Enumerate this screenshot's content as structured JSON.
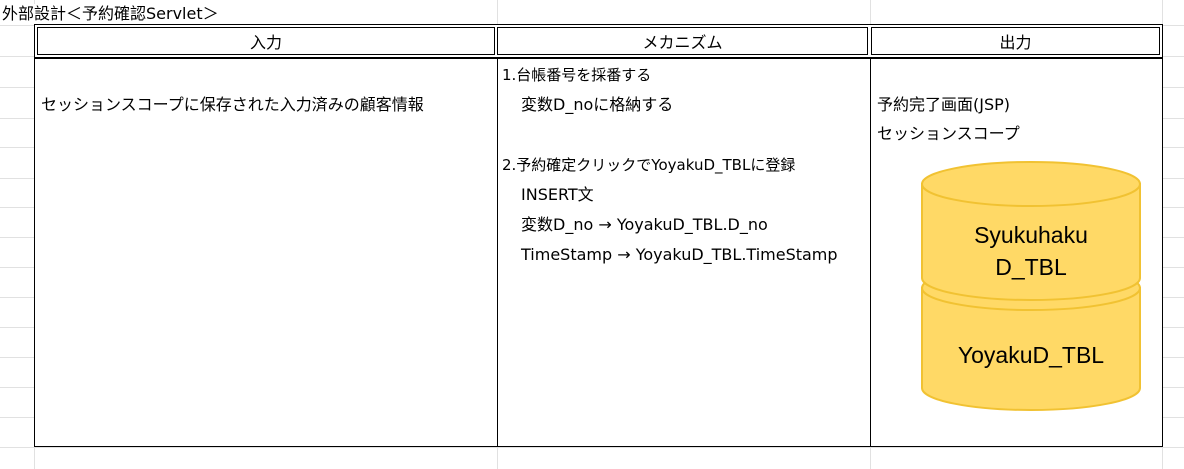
{
  "sheet": {
    "title": "外部設計＜予約確認Servlet＞"
  },
  "table": {
    "headers": [
      "入力",
      "メカニズム",
      "出力"
    ],
    "input": {
      "text": "セッションスコープに保存された入力済みの顧客情報"
    },
    "mechanism": {
      "step1_title": "1.台帳番号を採番する",
      "step1_detail": "変数D_noに格納する",
      "step2_title": "2.予約確定クリックでYoyakuD_TBLに登録",
      "step2_lines": [
        "INSERT文",
        "変数D_no → YoyakuD_TBL.D_no",
        "TimeStamp → YoyakuD_TBL.TimeStamp"
      ]
    },
    "output": {
      "line1": "予約完了画面(JSP)",
      "line2": "セッションスコープ",
      "database": {
        "top_label_line1": "Syukuhaku",
        "top_label_line2": "D_TBL",
        "bottom_label": "YoyakuD_TBL",
        "fill_color": "#ffd966",
        "stroke_color": "#f1c232"
      }
    }
  }
}
